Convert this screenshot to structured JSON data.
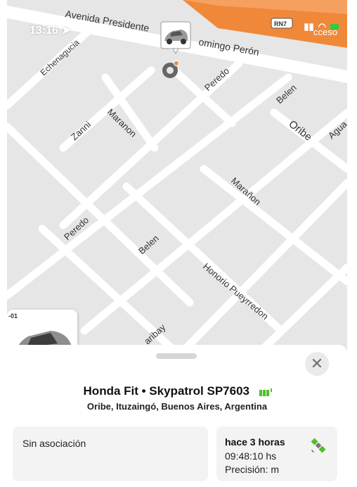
{
  "status_bar": {
    "time": "13:16",
    "network": "",
    "battery": ""
  },
  "map": {
    "streets": {
      "avenida_presidente": "Avenida Presidente",
      "domingo_peron": "omingo Perón",
      "echenagucia": "Echenagucia",
      "peredo_top": "Peredo",
      "belen_top": "Belen",
      "oribe": "Oribe",
      "aguado": "Agua",
      "zanni": "Zanni",
      "maranon_top": "Maranon",
      "maranon_mid": "Marañon",
      "peredo_mid": "Peredo",
      "belen_mid": "Belen",
      "honorio": "Honorio Pueyrredon",
      "garibay": "aribay",
      "acceso": "cceso",
      "rn7": "RN7"
    },
    "thumb_label": "-01"
  },
  "vehicle": {
    "title": "Honda Fit • Skypatrol SP7603",
    "address": "Oribe, Ituzaingó, Buenos Aires, Argentina",
    "association": "Sin asociación",
    "last_seen": "hace 3 horas",
    "time": "09:48:10 hs",
    "precision": "Precisión:  m"
  },
  "colors": {
    "accent_green": "#4fbf2a",
    "highway": "#f08a3c",
    "map_bg": "#e8e8e8"
  },
  "icons": {
    "close": "close-icon",
    "satellite": "satellite-icon",
    "battery": "battery-icon"
  }
}
